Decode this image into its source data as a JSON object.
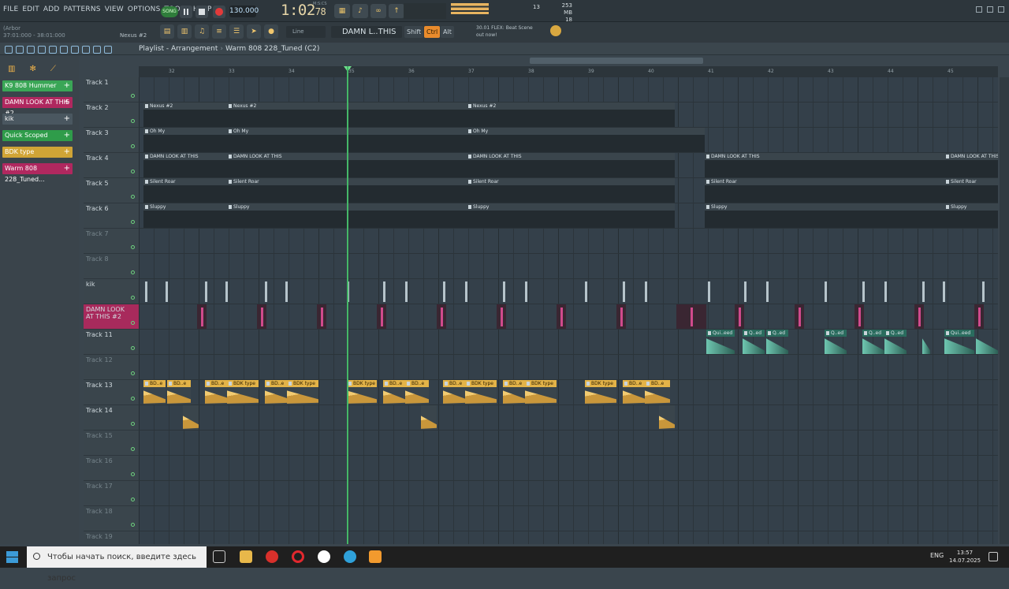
{
  "menu": [
    "FILE",
    "EDIT",
    "ADD",
    "PATTERNS",
    "VIEW",
    "OPTIONS",
    "TOOLS",
    "HELP"
  ],
  "transport": {
    "mode": "SONG",
    "tempo": "130.000",
    "time": "1:02",
    "time_small": "78",
    "time_label": "M:S:CS"
  },
  "memory": {
    "mb": "253 MB",
    "voices": "18",
    "cpu": "13"
  },
  "hint": {
    "line1": "(Arbor",
    "line2": "37:01:000 - 38:01:000"
  },
  "channel": "Nexus #2",
  "snap": "Line",
  "pattern_selector": "DAMN L..THIS",
  "keys": {
    "shift": "Shift",
    "ctrl": "Ctrl",
    "alt": "Alt"
  },
  "news": {
    "line1": "30.01 FLEX: Beat Scene",
    "line2": "out now!"
  },
  "breadcrumb": {
    "root": "Playlist - Arrangement",
    "current": "Warm 808 228_Tuned (C2)"
  },
  "patterns": [
    {
      "name": "K9 808 Hummer",
      "color": "#3aa656"
    },
    {
      "name": "DAMN LOOK AT THIS #2",
      "color": "#b0285f"
    },
    {
      "name": "kik",
      "color": "#4a5760"
    },
    {
      "name": "Quick Scoped",
      "color": "#2f9c4a"
    },
    {
      "name": "BDK type",
      "color": "#d0a436"
    },
    {
      "name": "Warm 808 228_Tuned...",
      "color": "#b0285f"
    }
  ],
  "ruler": [
    "32",
    "33",
    "34",
    "35",
    "36",
    "37",
    "38",
    "39",
    "40",
    "41",
    "42",
    "43",
    "44",
    "45"
  ],
  "tracks": [
    {
      "name": "Track 1",
      "dim": false
    },
    {
      "name": "Track 2",
      "dim": false
    },
    {
      "name": "Track 3",
      "dim": false
    },
    {
      "name": "Track 4",
      "dim": false
    },
    {
      "name": "Track 5",
      "dim": false
    },
    {
      "name": "Track 6",
      "dim": false
    },
    {
      "name": "Track 7",
      "dim": true
    },
    {
      "name": "Track 8",
      "dim": true
    },
    {
      "name": "kik",
      "dim": false
    },
    {
      "name": "DAMN LOOK AT THIS #2",
      "dim": false
    },
    {
      "name": "Track 11",
      "dim": false
    },
    {
      "name": "Track 12",
      "dim": true
    },
    {
      "name": "Track 13",
      "dim": false
    },
    {
      "name": "Track 14",
      "dim": false
    },
    {
      "name": "Track 15",
      "dim": true
    },
    {
      "name": "Track 16",
      "dim": true
    },
    {
      "name": "Track 17",
      "dim": true
    },
    {
      "name": "Track 18",
      "dim": true
    },
    {
      "name": "Track 19",
      "dim": true
    }
  ],
  "clip_labels": {
    "nexus": "Nexus #2",
    "ohmy": "Oh My",
    "damn": "DAMN LOOK AT THIS",
    "silent": "Silent Roar",
    "sluppy": "Sluppy",
    "bdk": "BDK type",
    "bde": "BD..e",
    "quick": "Qui..eed",
    "q": "Q..ed"
  },
  "taskbar": {
    "search": "Чтобы начать поиск, введите здесь запрос",
    "lang": "ENG",
    "time": "13:57",
    "date": "14.07.2025"
  }
}
